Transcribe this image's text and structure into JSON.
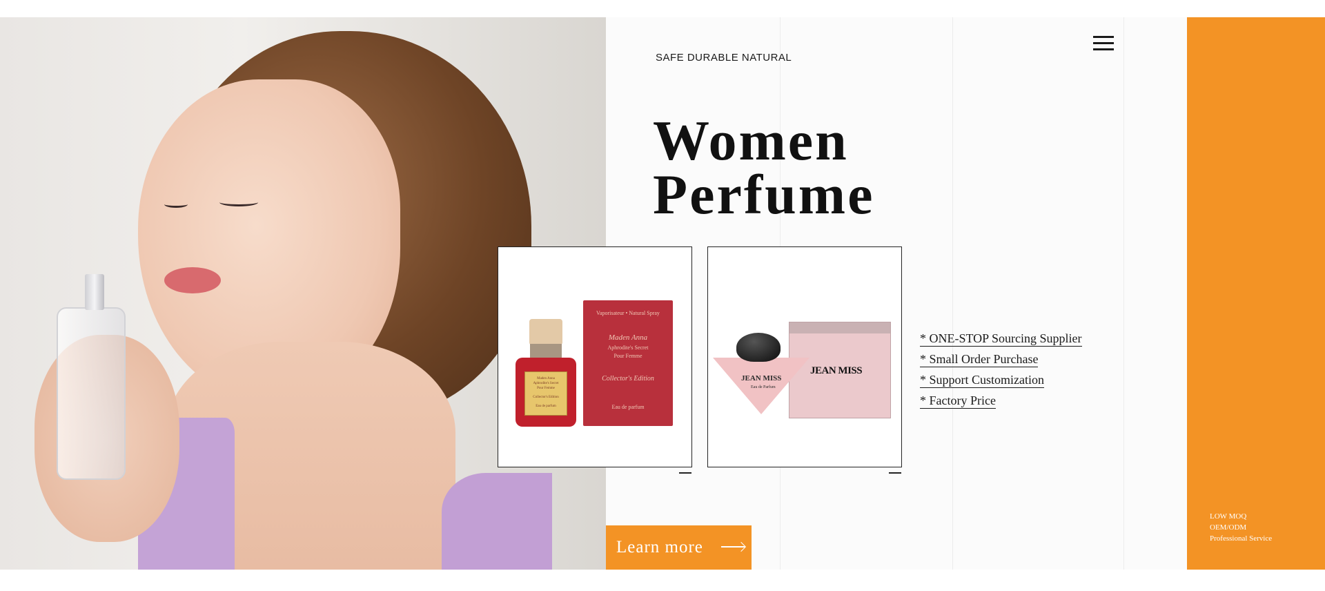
{
  "header": {
    "slogan": "SAFE DURABLE NATURAL",
    "menu_icon": "hamburger-menu-icon"
  },
  "hero": {
    "title_line1": "Women",
    "title_line2": "Perfume",
    "image": "woman-with-perfume-photo"
  },
  "products": [
    {
      "image": "red-perfume-bottle-and-box",
      "box_spray": "Vaporisateur • Natural Spray",
      "box_brand": "Maden Anna",
      "box_line1": "Aphrodite's Secret",
      "box_line2": "Pour Femme",
      "box_edition": "Collector's Edition",
      "box_type": "Eau de parfum"
    },
    {
      "image": "pink-perfume-bottle-and-box",
      "box_brand": "JEAN MISS",
      "bottle_brand": "JEAN MISS",
      "bottle_type": "Eau de Parfum"
    }
  ],
  "features": [
    "* ONE-STOP Sourcing Supplier",
    "* Small Order Purchase",
    "* Support Customization",
    "* Factory Price"
  ],
  "cta": {
    "label": "Learn more",
    "icon": "arrow-right-icon"
  },
  "side_panel": {
    "lines": [
      "LOW MOQ",
      "OEM/ODM",
      "Professional Service"
    ]
  },
  "colors": {
    "accent": "#f39325",
    "text": "#1a1a1a",
    "background": "#fbfbfb"
  }
}
